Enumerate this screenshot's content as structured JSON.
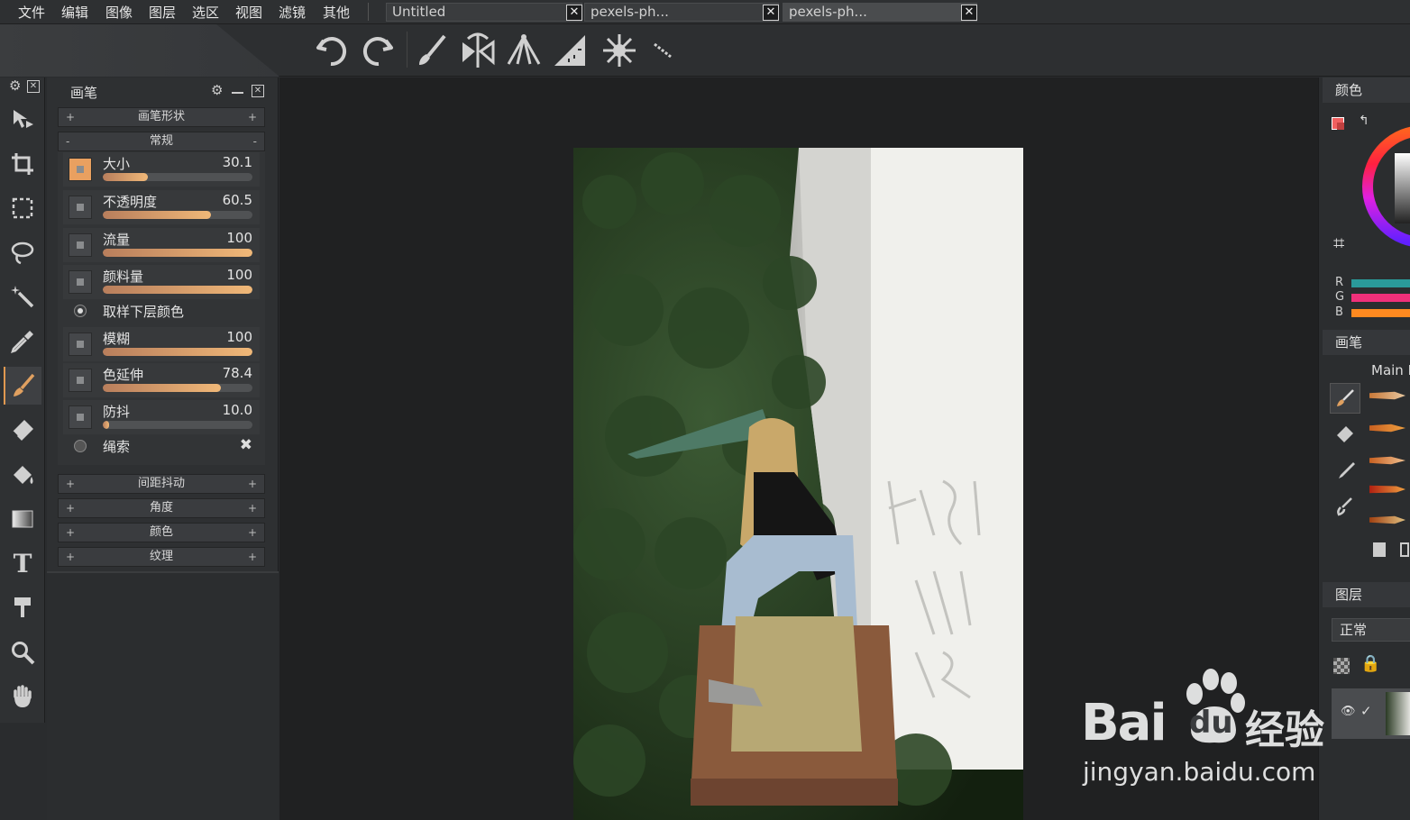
{
  "menu": [
    "文件",
    "编辑",
    "图像",
    "图层",
    "选区",
    "视图",
    "滤镜",
    "其他"
  ],
  "tabs": [
    {
      "label": "Untitled",
      "close": "✕"
    },
    {
      "label": "pexels-ph...",
      "close": "✕"
    },
    {
      "label": "pexels-ph...",
      "close": "✕"
    }
  ],
  "toolbar": {
    "icons": [
      "undo-icon",
      "redo-icon",
      "brush-icon",
      "symmetry-icon",
      "perspective-icon",
      "ruler-icon",
      "kaleidoscope-icon",
      "line-icon"
    ]
  },
  "tools": [
    "move-icon",
    "crop-icon",
    "rect-select-icon",
    "lasso-icon",
    "magic-wand-icon",
    "eyedropper-icon",
    "brush-icon",
    "eraser-icon",
    "bucket-icon",
    "gradient-icon",
    "text-icon",
    "smudge-icon",
    "zoom-icon",
    "hand-icon"
  ],
  "brush_panel": {
    "title": "画笔",
    "sections_top": [
      {
        "label": "画笔形状",
        "toggle": "+"
      }
    ],
    "general": {
      "label": "常规",
      "toggle": "-"
    },
    "params": [
      {
        "label": "大小",
        "value": "30.1",
        "fraction": 0.3
      },
      {
        "label": "不透明度",
        "value": "60.5",
        "fraction": 0.72
      },
      {
        "label": "流量",
        "value": "100",
        "fraction": 1.0
      },
      {
        "label": "颜料量",
        "value": "100",
        "fraction": 1.0
      }
    ],
    "sample_option": "取样下层颜色",
    "params2": [
      {
        "label": "模糊",
        "value": "100",
        "fraction": 1.0
      },
      {
        "label": "色延伸",
        "value": "78.4",
        "fraction": 0.79
      },
      {
        "label": "防抖",
        "value": "10.0",
        "fraction": 0.04
      }
    ],
    "rope_option": "绳索",
    "sections_bottom": [
      {
        "label": "间距抖动",
        "toggle": "+"
      },
      {
        "label": "角度",
        "toggle": "+"
      },
      {
        "label": "颜色",
        "toggle": "+"
      },
      {
        "label": "纹理",
        "toggle": "+"
      }
    ]
  },
  "right_panel": {
    "color_title": "颜色",
    "rgb": [
      "R",
      "G",
      "B"
    ],
    "brush_title": "画笔",
    "brush_set": "Main E",
    "layers_title": "图层",
    "blend_mode": "正常"
  },
  "colors": {
    "accent": "#e09850",
    "r_bar": "#2a9a9a",
    "g_bar": "#f0307a",
    "b_bar": "#ff8a20",
    "primary_swatch": "#f06060"
  },
  "watermark": {
    "brand": "Bai",
    "brand2": "du",
    "suffix": "经验",
    "url": "jingyan.baidu.com"
  }
}
